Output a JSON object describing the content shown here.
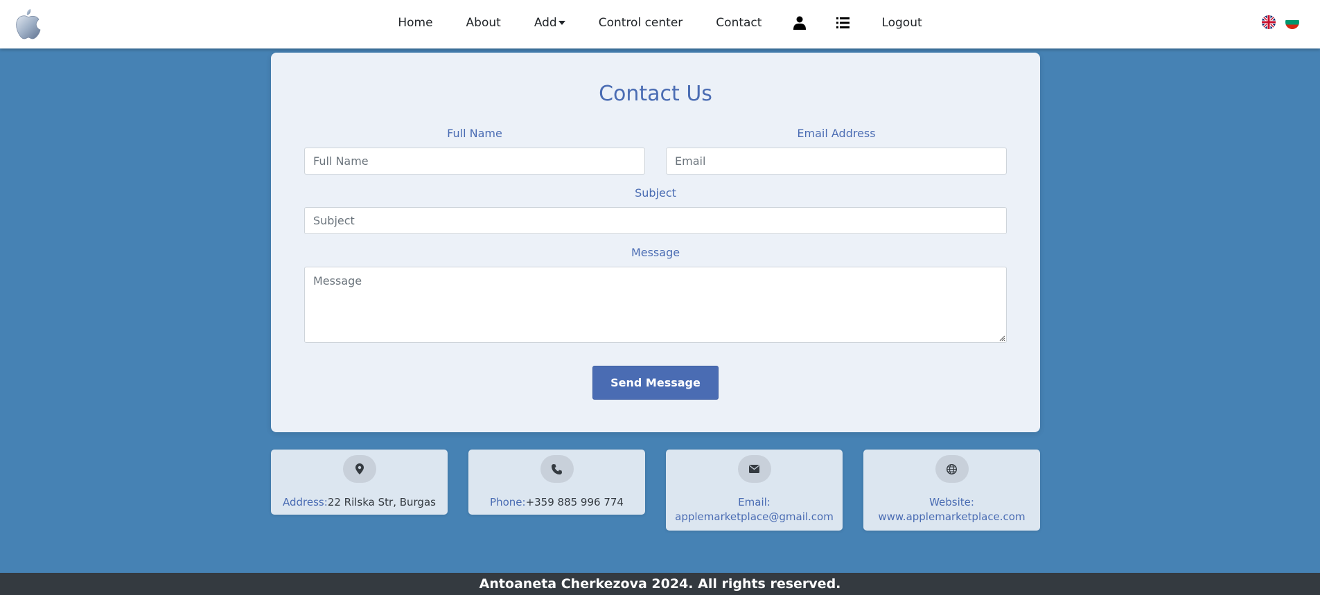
{
  "nav": {
    "logo": "apple-logo",
    "items": [
      {
        "label": "Home"
      },
      {
        "label": "About"
      },
      {
        "label": "Add"
      },
      {
        "label": "Control center"
      },
      {
        "label": "Contact"
      }
    ],
    "logout_label": "Logout",
    "icons": [
      "user-icon",
      "list-icon"
    ],
    "flags": [
      "uk-flag",
      "bulgaria-flag"
    ]
  },
  "contact": {
    "title": "Contact Us",
    "full_name": {
      "label": "Full Name",
      "placeholder": "Full Name",
      "value": ""
    },
    "email": {
      "label": "Email Address",
      "placeholder": "Email",
      "value": ""
    },
    "subject": {
      "label": "Subject",
      "placeholder": "Subject",
      "value": ""
    },
    "message": {
      "label": "Message",
      "placeholder": "Message",
      "value": ""
    },
    "send_label": "Send Message"
  },
  "info": {
    "address": {
      "key": "Address:",
      "value": "22 Rilska Str, Burgas",
      "icon": "map-pin-icon"
    },
    "phone": {
      "key": "Phone:",
      "value": "+359 885 996 774",
      "icon": "phone-icon"
    },
    "email": {
      "key": "Email:",
      "value": "applemarketplace@gmail.com",
      "icon": "envelope-icon"
    },
    "website": {
      "key": "Website:",
      "value": "www.applemarketplace.com",
      "icon": "globe-icon"
    }
  },
  "footer": {
    "text": "Antoaneta Cherkezova 2024. All rights reserved."
  },
  "colors": {
    "background": "#4682b4",
    "accent": "#4a6cb3",
    "card": "#ecf1f8",
    "footer": "#343a40"
  }
}
